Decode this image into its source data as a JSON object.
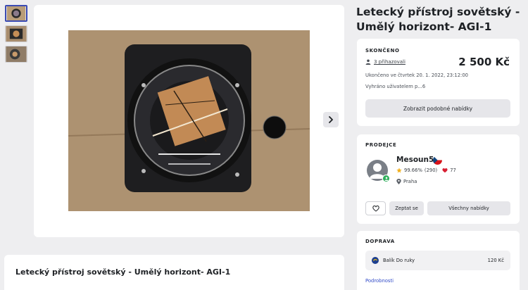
{
  "listing": {
    "title": "Letecký přístroj sovětský - Umělý horizont- AGI-1"
  },
  "gallery": {
    "thumbnail_count": 3,
    "active_thumbnail": 1
  },
  "status": {
    "label": "SKONČENO",
    "bidders_link": "3 přihazovali",
    "price": "2 500 Kč",
    "ended_text": "Ukončeno ve čtvrtek 20. 1. 2022, 23:12:00",
    "won_text": "Vyhráno uživatelem p...6",
    "similar_button": "Zobrazit podobné nabídky"
  },
  "seller": {
    "label": "PRODEJCE",
    "name": "Mesoun5",
    "rating_percent": "99.66%",
    "rating_count": "(290)",
    "hearts": "77",
    "city": "Praha",
    "ask_button": "Zeptat se",
    "all_offers_button": "Všechny nabídky"
  },
  "shipping": {
    "label": "DOPRAVA",
    "method": "Balík Do ruky",
    "price": "120 Kč",
    "details_link": "Podrobnosti"
  },
  "colors": {
    "accent": "#3b4bb3",
    "link": "#2f49c7",
    "verified": "#2fae5b",
    "star": "#f2b01e",
    "heart": "#d81f33"
  }
}
